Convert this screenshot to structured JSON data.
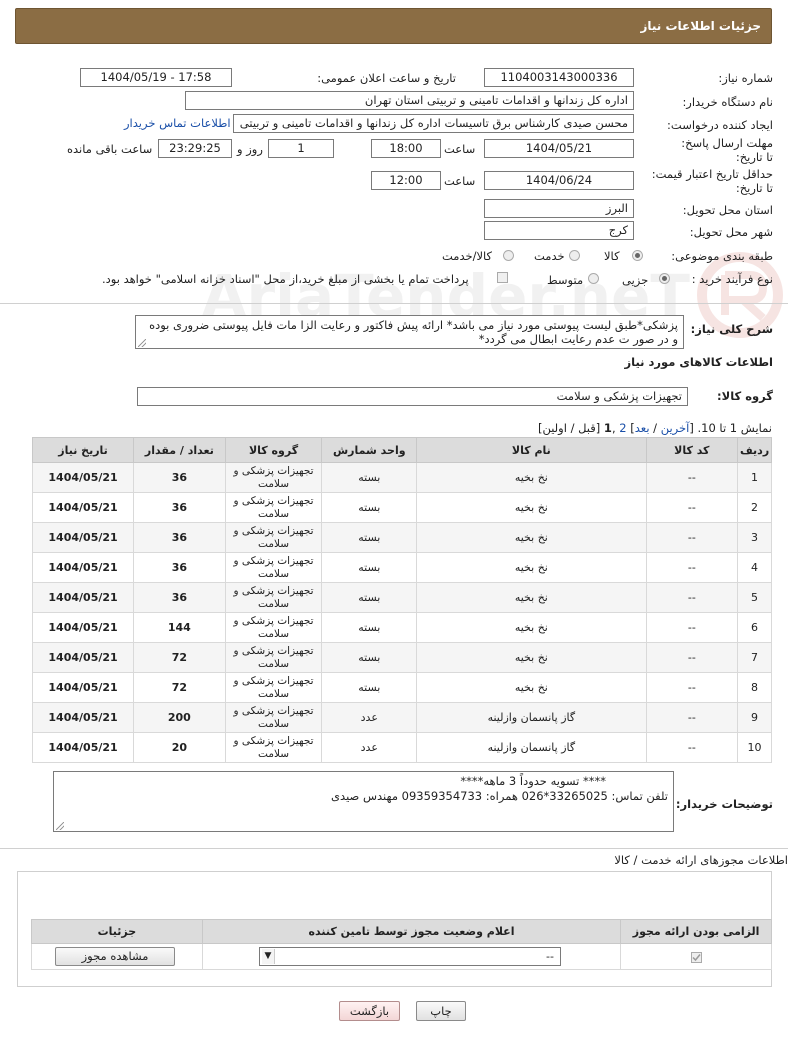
{
  "header": {
    "title": "جزئیات اطلاعات نیاز"
  },
  "fields": {
    "need_number_label": "شماره نیاز:",
    "need_number": "1104003143000336",
    "announce_label": "تاریخ و ساعت اعلان عمومی:",
    "announce_value": "1404/05/19 - 17:58",
    "buyer_org_label": "نام دستگاه خریدار:",
    "buyer_org": "اداره کل زندانها و اقدامات تامینی و تربیتی استان تهران",
    "creator_label": "ایجاد کننده درخواست:",
    "creator": "محسن صیدی کارشناس برق تاسیسات  اداره کل زندانها و اقدامات تامینی و تربیتی",
    "contact_link": "اطلاعات تماس خریدار",
    "reply_deadline_label": "مهلت ارسال پاسخ: تا تاریخ:",
    "reply_date": "1404/05/21",
    "time_label": "ساعت",
    "reply_time": "18:00",
    "days_value": "1",
    "days_label": "روز و",
    "remaining_time": "23:29:25",
    "remaining_label": "ساعت باقی مانده",
    "price_deadline_label": "حداقل تاریخ اعتبار قیمت: تا تاریخ:",
    "price_date": "1404/06/24",
    "price_time": "12:00",
    "province_label": "استان محل تحویل:",
    "province": "البرز",
    "city_label": "شهر محل تحویل:",
    "city": "کرج",
    "category_label": "طبقه بندی موضوعی:",
    "category_options": [
      "کالا",
      "خدمت",
      "کالا/خدمت"
    ],
    "process_label": "نوع فرآیند خرید :",
    "process_options": [
      "جزیی",
      "متوسط"
    ],
    "payment_note": "پرداخت تمام یا بخشی از مبلغ خرید،از محل \"اسناد خزانه اسلامی\" خواهد بود."
  },
  "description": {
    "label": "شرح کلی نیاز:",
    "text": "پزشکی*طبق لیست پیوستی مورد نیاز می باشد* ارائه پیش فاکتور و رعایت الزا مات فایل پیوستی ضروری بوده و در صور ت عدم رعایت ابطال می گردد*"
  },
  "goods": {
    "section_title": "اطلاعات کالاهای مورد نیاز",
    "group_label": "گروه کالا:",
    "group_value": "تجهیزات پزشکی و سلامت",
    "pagination": {
      "prefix": "نمایش 1 تا 10. [",
      "last": "آخرین",
      "sep1": " / ",
      "next": "بعد",
      "sep2": "] ",
      "page2": "2",
      "comma": " ,",
      "page1": "1",
      "suffix": " [قبل / اولین]"
    },
    "columns": [
      "ردیف",
      "کد کالا",
      "نام کالا",
      "واحد شمارش",
      "گروه کالا",
      "تعداد / مقدار",
      "تاریخ نیاز"
    ],
    "rows": [
      {
        "n": "1",
        "code": "--",
        "name": "نخ بخیه",
        "unit": "بسته",
        "group": "تجهیزات پزشکی و سلامت",
        "qty": "36",
        "date": "1404/05/21"
      },
      {
        "n": "2",
        "code": "--",
        "name": "نخ بخیه",
        "unit": "بسته",
        "group": "تجهیزات پزشکی و سلامت",
        "qty": "36",
        "date": "1404/05/21"
      },
      {
        "n": "3",
        "code": "--",
        "name": "نخ بخیه",
        "unit": "بسته",
        "group": "تجهیزات پزشکی و سلامت",
        "qty": "36",
        "date": "1404/05/21"
      },
      {
        "n": "4",
        "code": "--",
        "name": "نخ بخیه",
        "unit": "بسته",
        "group": "تجهیزات پزشکی و سلامت",
        "qty": "36",
        "date": "1404/05/21"
      },
      {
        "n": "5",
        "code": "--",
        "name": "نخ بخیه",
        "unit": "بسته",
        "group": "تجهیزات پزشکی و سلامت",
        "qty": "36",
        "date": "1404/05/21"
      },
      {
        "n": "6",
        "code": "--",
        "name": "نخ بخیه",
        "unit": "بسته",
        "group": "تجهیزات پزشکی و سلامت",
        "qty": "144",
        "date": "1404/05/21"
      },
      {
        "n": "7",
        "code": "--",
        "name": "نخ بخیه",
        "unit": "بسته",
        "group": "تجهیزات پزشکی و سلامت",
        "qty": "72",
        "date": "1404/05/21"
      },
      {
        "n": "8",
        "code": "--",
        "name": "نخ بخیه",
        "unit": "بسته",
        "group": "تجهیزات پزشکی و سلامت",
        "qty": "72",
        "date": "1404/05/21"
      },
      {
        "n": "9",
        "code": "--",
        "name": "گاز پانسمان وازلینه",
        "unit": "عدد",
        "group": "تجهیزات پزشکی و سلامت",
        "qty": "200",
        "date": "1404/05/21"
      },
      {
        "n": "10",
        "code": "--",
        "name": "گاز پانسمان وازلینه",
        "unit": "عدد",
        "group": "تجهیزات پزشکی و سلامت",
        "qty": "20",
        "date": "1404/05/21"
      }
    ]
  },
  "buyer_notes": {
    "label": "توضیحات خریدار:",
    "line1": "**** تسویه حدوداً 3 ماهه****",
    "line2": "تلفن تماس: 33265025*026        همراه: 09359354733     مهندس صیدی"
  },
  "licenses": {
    "section_title": "اطلاعات مجوزهای ارائه خدمت / کالا",
    "columns": [
      "الزامی بودن ارائه مجوز",
      "اعلام وضعیت مجوز توسط تامین کننده",
      "جزئیات"
    ],
    "select_value": "--",
    "view_button": "مشاهده مجوز"
  },
  "actions": {
    "print": "چاپ",
    "back": "بازگشت"
  },
  "watermark": "AriaTender.neT"
}
